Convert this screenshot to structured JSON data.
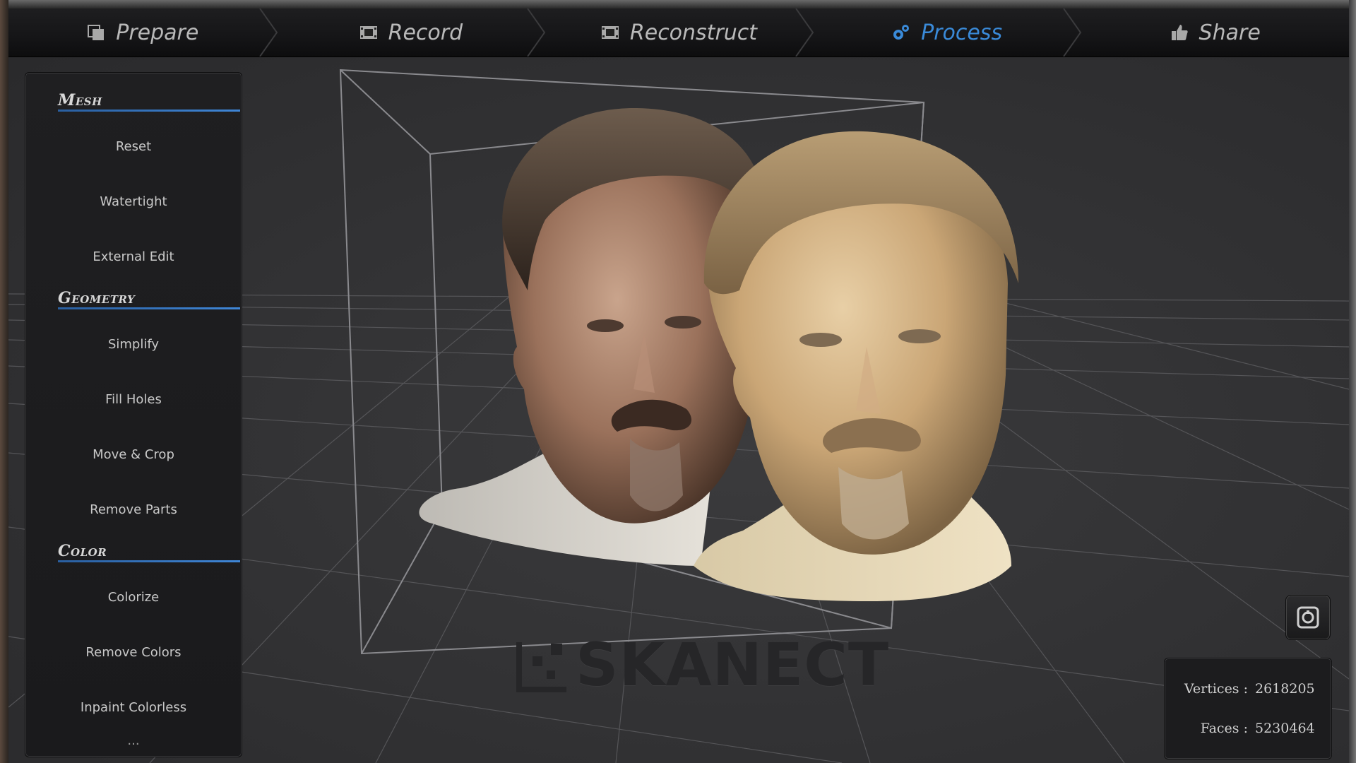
{
  "workflow": {
    "steps": [
      {
        "label": "Prepare",
        "icon": "prepare-icon",
        "active": false
      },
      {
        "label": "Record",
        "icon": "film-icon",
        "active": false
      },
      {
        "label": "Reconstruct",
        "icon": "film-icon",
        "active": false
      },
      {
        "label": "Process",
        "icon": "gears-icon",
        "active": true
      },
      {
        "label": "Share",
        "icon": "thumbs-up-icon",
        "active": false
      }
    ],
    "active_color": "#3a8ad8",
    "inactive_color": "#b9b9b9"
  },
  "panel": {
    "sections": [
      {
        "title": "Mesh",
        "items": [
          "Reset",
          "Watertight",
          "External Edit"
        ]
      },
      {
        "title": "Geometry",
        "items": [
          "Simplify",
          "Fill Holes",
          "Move & Crop",
          "Remove Parts"
        ]
      },
      {
        "title": "Color",
        "items": [
          "Colorize",
          "Remove Colors",
          "Inpaint Colorless"
        ]
      }
    ],
    "more": "..."
  },
  "stats": {
    "vertices_label": "Vertices :",
    "vertices_value": "2618205",
    "faces_label": "Faces :",
    "faces_value": "5230464"
  },
  "viewport": {
    "watermark": "SKANECT",
    "snapshot_icon": "camera-icon"
  },
  "colors": {
    "accent": "#3a8ad8",
    "background": "#2e2e30"
  }
}
